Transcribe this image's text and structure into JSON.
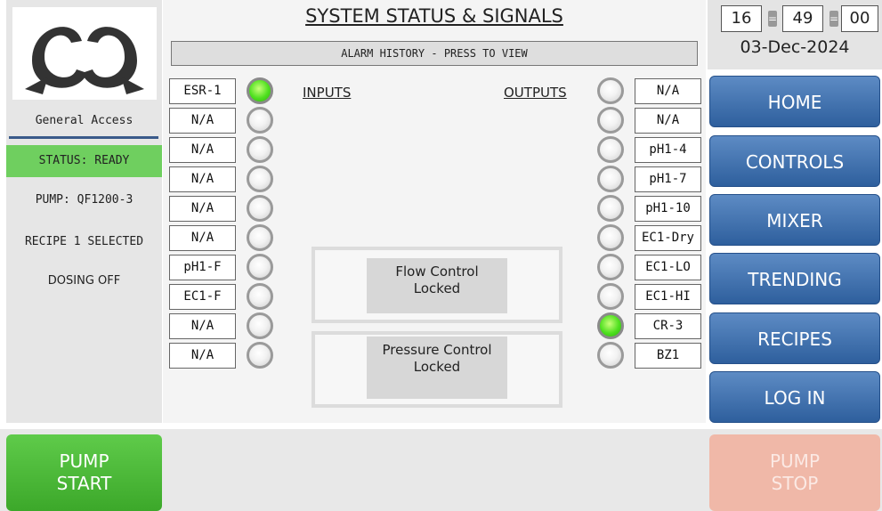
{
  "title": "SYSTEM STATUS & SIGNALS",
  "alarm_button": "ALARM HISTORY - PRESS TO VIEW",
  "clock": {
    "hour": "16",
    "minute": "49",
    "second": "00",
    "separator": "=",
    "date": "03-Dec-2024"
  },
  "left_panel": {
    "access": "General Access",
    "status": "STATUS: READY",
    "pump": "PUMP: QF1200-3",
    "recipe": "RECIPE 1 SELECTED",
    "dosing": "DOSING OFF"
  },
  "inputs": {
    "header": "INPUTS",
    "items": [
      {
        "label": "ESR-1",
        "on": true
      },
      {
        "label": "N/A",
        "on": false
      },
      {
        "label": "N/A",
        "on": false
      },
      {
        "label": "N/A",
        "on": false
      },
      {
        "label": "N/A",
        "on": false
      },
      {
        "label": "N/A",
        "on": false
      },
      {
        "label": "pH1-F",
        "on": false
      },
      {
        "label": "EC1-F",
        "on": false
      },
      {
        "label": "N/A",
        "on": false
      },
      {
        "label": "N/A",
        "on": false
      }
    ]
  },
  "outputs": {
    "header": "OUTPUTS",
    "items": [
      {
        "label": "N/A",
        "on": false
      },
      {
        "label": "N/A",
        "on": false
      },
      {
        "label": "pH1-4",
        "on": false
      },
      {
        "label": "pH1-7",
        "on": false
      },
      {
        "label": "pH1-10",
        "on": false
      },
      {
        "label": "EC1-Dry",
        "on": false
      },
      {
        "label": "EC1-LO",
        "on": false
      },
      {
        "label": "EC1-HI",
        "on": false
      },
      {
        "label": "CR-3",
        "on": true
      },
      {
        "label": "BZ1",
        "on": false
      }
    ]
  },
  "flow_control": "Flow Control\nLocked",
  "pressure_control": "Pressure Control\nLocked",
  "nav": [
    "HOME",
    "CONTROLS",
    "MIXER",
    "TRENDING",
    "RECIPES",
    "LOG IN"
  ],
  "pump_start": "PUMP\nSTART",
  "pump_stop": "PUMP\nSTOP",
  "colors": {
    "nav_blue": "#3a6aa8",
    "status_green": "#6fcf5f",
    "start_green": "#4cb83a",
    "stop_salmon": "#f0b8a8",
    "led_on": "#4fe01f"
  }
}
